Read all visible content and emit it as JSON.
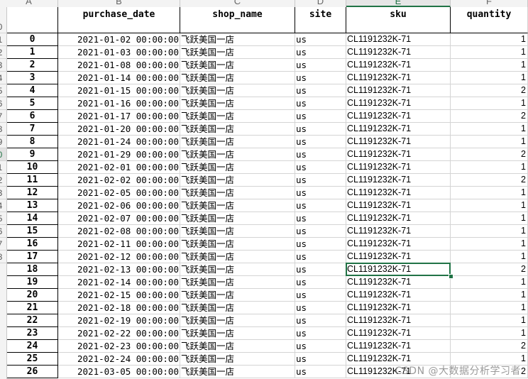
{
  "column_letters": [
    "A",
    "B",
    "C",
    "D",
    "E",
    "F"
  ],
  "active_column": "E",
  "row_numbers": [
    "",
    "",
    "",
    "",
    "",
    "",
    "",
    "",
    "",
    "0",
    "1",
    "2",
    "3",
    "4",
    "5",
    "6",
    "7",
    "8",
    "9",
    "0",
    "1",
    "2",
    "3",
    "4",
    "5",
    "6",
    "7",
    "8"
  ],
  "active_row_index": 19,
  "headers": [
    "",
    "purchase_date",
    "shop_name",
    "site",
    "sku",
    "quantity"
  ],
  "rows": [
    {
      "index": "0",
      "purchase_date": "2021-01-02 00:00:00",
      "shop_name": "飞跃美国一店",
      "site": "us",
      "sku": "CL1191232K-71",
      "quantity": "1"
    },
    {
      "index": "1",
      "purchase_date": "2021-01-03 00:00:00",
      "shop_name": "飞跃美国一店",
      "site": "us",
      "sku": "CL1191232K-71",
      "quantity": "1"
    },
    {
      "index": "2",
      "purchase_date": "2021-01-08 00:00:00",
      "shop_name": "飞跃美国一店",
      "site": "us",
      "sku": "CL1191232K-71",
      "quantity": "1"
    },
    {
      "index": "3",
      "purchase_date": "2021-01-14 00:00:00",
      "shop_name": "飞跃美国一店",
      "site": "us",
      "sku": "CL1191232K-71",
      "quantity": "1"
    },
    {
      "index": "4",
      "purchase_date": "2021-01-15 00:00:00",
      "shop_name": "飞跃美国一店",
      "site": "us",
      "sku": "CL1191232K-71",
      "quantity": "2"
    },
    {
      "index": "5",
      "purchase_date": "2021-01-16 00:00:00",
      "shop_name": "飞跃美国一店",
      "site": "us",
      "sku": "CL1191232K-71",
      "quantity": "1"
    },
    {
      "index": "6",
      "purchase_date": "2021-01-17 00:00:00",
      "shop_name": "飞跃美国一店",
      "site": "us",
      "sku": "CL1191232K-71",
      "quantity": "2"
    },
    {
      "index": "7",
      "purchase_date": "2021-01-20 00:00:00",
      "shop_name": "飞跃美国一店",
      "site": "us",
      "sku": "CL1191232K-71",
      "quantity": "1"
    },
    {
      "index": "8",
      "purchase_date": "2021-01-24 00:00:00",
      "shop_name": "飞跃美国一店",
      "site": "us",
      "sku": "CL1191232K-71",
      "quantity": "1"
    },
    {
      "index": "9",
      "purchase_date": "2021-01-29 00:00:00",
      "shop_name": "飞跃美国一店",
      "site": "us",
      "sku": "CL1191232K-71",
      "quantity": "2"
    },
    {
      "index": "10",
      "purchase_date": "2021-02-01 00:00:00",
      "shop_name": "飞跃美国一店",
      "site": "us",
      "sku": "CL1191232K-71",
      "quantity": "1"
    },
    {
      "index": "11",
      "purchase_date": "2021-02-02 00:00:00",
      "shop_name": "飞跃美国一店",
      "site": "us",
      "sku": "CL1191232K-71",
      "quantity": "2"
    },
    {
      "index": "12",
      "purchase_date": "2021-02-05 00:00:00",
      "shop_name": "飞跃美国一店",
      "site": "us",
      "sku": "CL1191232K-71",
      "quantity": "1"
    },
    {
      "index": "13",
      "purchase_date": "2021-02-06 00:00:00",
      "shop_name": "飞跃美国一店",
      "site": "us",
      "sku": "CL1191232K-71",
      "quantity": "1"
    },
    {
      "index": "14",
      "purchase_date": "2021-02-07 00:00:00",
      "shop_name": "飞跃美国一店",
      "site": "us",
      "sku": "CL1191232K-71",
      "quantity": "1"
    },
    {
      "index": "15",
      "purchase_date": "2021-02-08 00:00:00",
      "shop_name": "飞跃美国一店",
      "site": "us",
      "sku": "CL1191232K-71",
      "quantity": "1"
    },
    {
      "index": "16",
      "purchase_date": "2021-02-11 00:00:00",
      "shop_name": "飞跃美国一店",
      "site": "us",
      "sku": "CL1191232K-71",
      "quantity": "1"
    },
    {
      "index": "17",
      "purchase_date": "2021-02-12 00:00:00",
      "shop_name": "飞跃美国一店",
      "site": "us",
      "sku": "CL1191232K-71",
      "quantity": "1"
    },
    {
      "index": "18",
      "purchase_date": "2021-02-13 00:00:00",
      "shop_name": "飞跃美国一店",
      "site": "us",
      "sku": "CL1191232K-71",
      "quantity": "2"
    },
    {
      "index": "19",
      "purchase_date": "2021-02-14 00:00:00",
      "shop_name": "飞跃美国一店",
      "site": "us",
      "sku": "CL1191232K-71",
      "quantity": "1"
    },
    {
      "index": "20",
      "purchase_date": "2021-02-15 00:00:00",
      "shop_name": "飞跃美国一店",
      "site": "us",
      "sku": "CL1191232K-71",
      "quantity": "1"
    },
    {
      "index": "21",
      "purchase_date": "2021-02-18 00:00:00",
      "shop_name": "飞跃美国一店",
      "site": "us",
      "sku": "CL1191232K-71",
      "quantity": "1"
    },
    {
      "index": "22",
      "purchase_date": "2021-02-19 00:00:00",
      "shop_name": "飞跃美国一店",
      "site": "us",
      "sku": "CL1191232K-71",
      "quantity": "1"
    },
    {
      "index": "23",
      "purchase_date": "2021-02-22 00:00:00",
      "shop_name": "飞跃美国一店",
      "site": "us",
      "sku": "CL1191232K-71",
      "quantity": "1"
    },
    {
      "index": "24",
      "purchase_date": "2021-02-23 00:00:00",
      "shop_name": "飞跃美国一店",
      "site": "us",
      "sku": "CL1191232K-71",
      "quantity": "2"
    },
    {
      "index": "25",
      "purchase_date": "2021-02-24 00:00:00",
      "shop_name": "飞跃美国一店",
      "site": "us",
      "sku": "CL1191232K-71",
      "quantity": "1"
    },
    {
      "index": "26",
      "purchase_date": "2021-03-05 00:00:00",
      "shop_name": "飞跃美国一店",
      "site": "us",
      "sku": "CL1191232K-71",
      "quantity": "2"
    }
  ],
  "selected_cell": {
    "row": "18",
    "column": "sku"
  },
  "colors": {
    "selection": "#217346",
    "grid_line": "#d4d4d4",
    "header_bg": "#f3f3f3"
  },
  "watermark": "CSDN @大数据分析学习者"
}
